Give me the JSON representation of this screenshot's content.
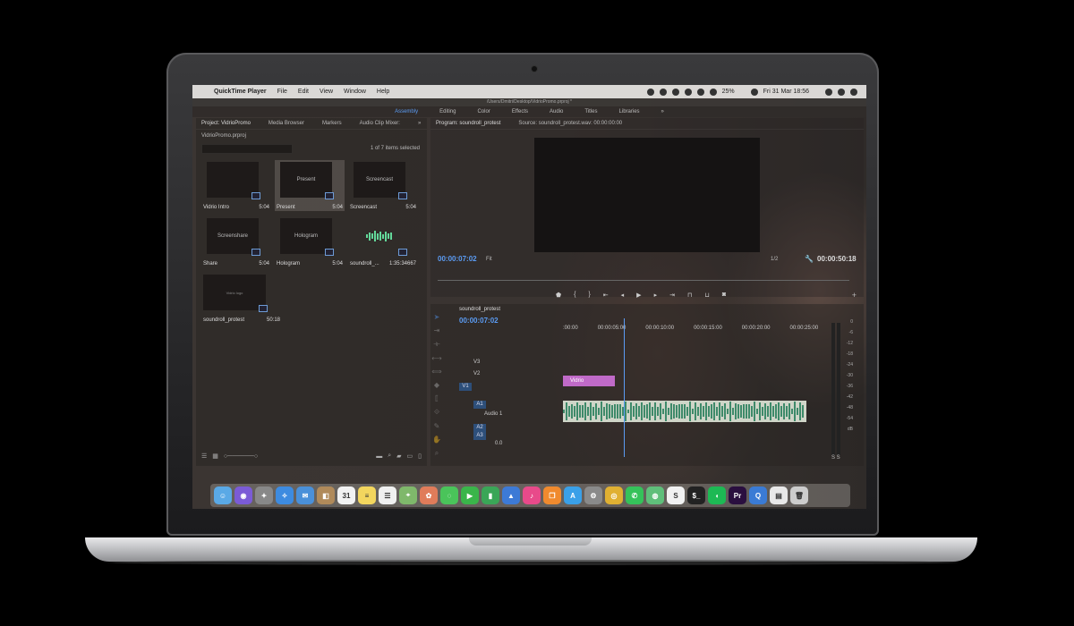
{
  "menubar": {
    "apple": "",
    "app": "QuickTime Player",
    "menus": [
      "File",
      "Edit",
      "View",
      "Window",
      "Help"
    ],
    "battery": "25%",
    "datetime": "Fri 31 Mar  18:56"
  },
  "path_title": "/Users/Dmitri/Desktop/VidrioPromo.prproj *",
  "workspaces": {
    "items": [
      "Assembly",
      "Editing",
      "Color",
      "Effects",
      "Audio",
      "Titles",
      "Libraries"
    ],
    "active": "Assembly",
    "more": "»"
  },
  "project_panel": {
    "tabs": [
      "Project: VidrioPromo",
      "Media Browser",
      "Markers",
      "Audio Clip Mixer:"
    ],
    "more": "»",
    "file": "VidrioPromo.prproj",
    "selection_count": "1 of 7 items selected",
    "clips": [
      {
        "name": "Vidrio Intro",
        "duration": "5:04",
        "thumb_label": ""
      },
      {
        "name": "Present",
        "duration": "5:04",
        "thumb_label": "Present"
      },
      {
        "name": "Screencast",
        "duration": "5:04",
        "thumb_label": "Screencast"
      },
      {
        "name": "Share",
        "duration": "5:04",
        "thumb_label": "Screenshare"
      },
      {
        "name": "Hologram",
        "duration": "5:04",
        "thumb_label": "Hologram"
      },
      {
        "name": "soundroll_...",
        "duration": "1:35:34667",
        "thumb_label": ""
      },
      {
        "name": "soundroll_protest",
        "duration": "50:18",
        "thumb_label": "Vidrio logo"
      }
    ]
  },
  "program_panel": {
    "tab": "Program: soundroll_protest",
    "source_tab": "Source: soundroll_protest.wav: 00:00:00:00",
    "timecode": "00:00:07:02",
    "fit": "Fit",
    "resolution": "1/2",
    "duration": "00:00:50:18"
  },
  "timeline": {
    "sequence": "soundroll_protest",
    "timecode": "00:00:07:02",
    "ruler": [
      ":00:00",
      "00:00:05:00",
      "00:00:10:00",
      "00:00:15:00",
      "00:00:20:00",
      "00:00:25:00"
    ],
    "tracks": [
      "V3",
      "V2",
      "V1",
      "A1",
      "A2",
      "A3"
    ],
    "audio_label": "Audio 1",
    "video_clip": "Vidrio",
    "volume": "0.0"
  },
  "meter": {
    "scale": [
      "0",
      "-6",
      "-12",
      "-18",
      "-24",
      "-30",
      "-36",
      "-42",
      "-48",
      "-54",
      "dB"
    ],
    "solo": "S  S"
  },
  "dock": {
    "apps": [
      {
        "icon": "finder-icon",
        "color": "#5aa9e6",
        "glyph": "☺"
      },
      {
        "icon": "siri-icon",
        "color": "#7b5bd6",
        "glyph": "◉"
      },
      {
        "icon": "launchpad-icon",
        "color": "#888888",
        "glyph": "✦"
      },
      {
        "icon": "safari-icon",
        "color": "#3d8be0",
        "glyph": "✧"
      },
      {
        "icon": "mail-icon",
        "color": "#4a90d9",
        "glyph": "✉"
      },
      {
        "icon": "contacts-icon",
        "color": "#b08a5a",
        "glyph": "◧"
      },
      {
        "icon": "calendar-icon",
        "color": "#f2f2f2",
        "glyph": "31"
      },
      {
        "icon": "notes-icon",
        "color": "#f3d65e",
        "glyph": "≡"
      },
      {
        "icon": "reminders-icon",
        "color": "#f0f0f0",
        "glyph": "☰"
      },
      {
        "icon": "maps-icon",
        "color": "#7fb86b",
        "glyph": "⌖"
      },
      {
        "icon": "photos-icon",
        "color": "#e07c5a",
        "glyph": "✿"
      },
      {
        "icon": "messages-icon",
        "color": "#4ac45a",
        "glyph": "◌"
      },
      {
        "icon": "facetime-icon",
        "color": "#3ab54a",
        "glyph": "▶"
      },
      {
        "icon": "numbers-icon",
        "color": "#3aa657",
        "glyph": "▮"
      },
      {
        "icon": "keynote-icon",
        "color": "#3d7ad6",
        "glyph": "▲"
      },
      {
        "icon": "itunes-icon",
        "color": "#e84a8a",
        "glyph": "♪"
      },
      {
        "icon": "ibooks-icon",
        "color": "#f08a2e",
        "glyph": "❐"
      },
      {
        "icon": "appstore-icon",
        "color": "#3aa0e8",
        "glyph": "A"
      },
      {
        "icon": "system-preferences-icon",
        "color": "#8a8a8a",
        "glyph": "⚙"
      },
      {
        "icon": "chrome-icon",
        "color": "#e0b032",
        "glyph": "◎"
      },
      {
        "icon": "whatsapp-icon",
        "color": "#35c25a",
        "glyph": "✆"
      },
      {
        "icon": "app-green-icon",
        "color": "#5fbf7a",
        "glyph": "◍"
      },
      {
        "icon": "slack-icon",
        "color": "#f1f1f1",
        "glyph": "S"
      },
      {
        "icon": "terminal-icon",
        "color": "#222222",
        "glyph": "$_"
      },
      {
        "icon": "spotify-icon",
        "color": "#1db954",
        "glyph": "◖"
      },
      {
        "icon": "premiere-icon",
        "color": "#2a0f3f",
        "glyph": "Pr"
      },
      {
        "icon": "quicktime-icon",
        "color": "#3a7bd5",
        "glyph": "Q"
      },
      {
        "icon": "document-icon",
        "color": "#e8e8e8",
        "glyph": "▤"
      },
      {
        "icon": "trash-icon",
        "color": "#cccccc",
        "glyph": "🗑"
      }
    ]
  }
}
